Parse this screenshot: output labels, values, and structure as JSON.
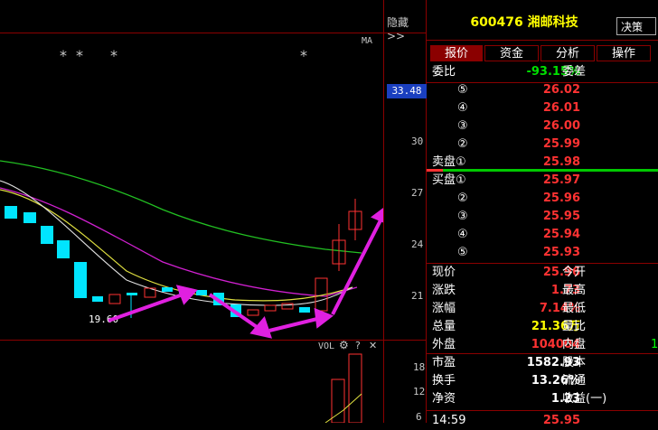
{
  "chart": {
    "hide_label": "隐藏>>",
    "ma_label": "MA",
    "stars": [
      "*",
      "*",
      "*",
      "*"
    ],
    "current_price_tag": "33.48",
    "y_ticks": [
      "30",
      "27",
      "24",
      "21"
    ],
    "low_label": "19.60",
    "vol_panel": {
      "label": "VOL",
      "gear": "⚙",
      "help": "?",
      "close": "✕",
      "y_ticks": [
        "18",
        "12",
        "6"
      ]
    }
  },
  "quote": {
    "code": "600476",
    "name": "湘邮科技",
    "decide_button": "决策",
    "tabs": [
      "报价",
      "资金",
      "分析",
      "操作"
    ],
    "weibi": {
      "label": "委比",
      "value": "-93.15%",
      "label2": "委差"
    },
    "sell": [
      {
        "n": "⑤",
        "price": "26.02"
      },
      {
        "n": "④",
        "price": "26.01"
      },
      {
        "n": "③",
        "price": "26.00"
      },
      {
        "n": "②",
        "price": "25.99"
      },
      {
        "n": "卖盘①",
        "price": "25.98"
      }
    ],
    "buy": [
      {
        "n": "买盘①",
        "price": "25.97"
      },
      {
        "n": "②",
        "price": "25.96"
      },
      {
        "n": "③",
        "price": "25.95"
      },
      {
        "n": "④",
        "price": "25.94"
      },
      {
        "n": "⑤",
        "price": "25.93"
      }
    ],
    "stats": [
      {
        "k": "现价",
        "v": "25.96",
        "k2": "今开",
        "cls": "red"
      },
      {
        "k": "涨跌",
        "v": "1.73",
        "k2": "最高",
        "cls": "red"
      },
      {
        "k": "涨幅",
        "v": "7.14%",
        "k2": "最低",
        "cls": "red"
      },
      {
        "k": "总量",
        "v": "21.36万",
        "k2": "量比",
        "cls": "yellow"
      },
      {
        "k": "外盘",
        "v": "104004",
        "k2": "内盘",
        "cls": "red",
        "v2": "1"
      },
      {
        "k": "市盈",
        "v": "1582.93",
        "k2": "股本",
        "cls": "white"
      },
      {
        "k": "换手",
        "v": "13.26%",
        "k2": "流通",
        "cls": "white"
      },
      {
        "k": "净资",
        "v": "1.23",
        "k2": "收益(一)",
        "cls": "white"
      }
    ],
    "time_row": {
      "time": "14:59",
      "price": "25.95"
    }
  }
}
